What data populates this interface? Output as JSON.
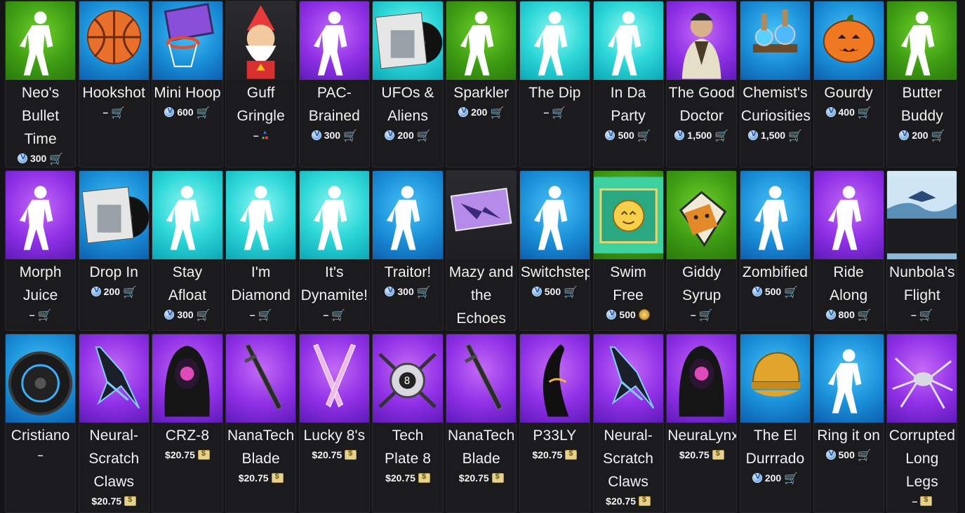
{
  "rows": [
    [
      {
        "name": "Neo's Bullet Time",
        "price": "300",
        "cur": "vbucks",
        "bg": "green",
        "icon": "emote-silhouette-icon"
      },
      {
        "name": "Hookshot",
        "price": "–",
        "cur": "cart",
        "bg": "blue",
        "icon": "basketball-icon"
      },
      {
        "name": "Mini Hoop",
        "price": "600",
        "cur": "vbucks",
        "bg": "blue",
        "icon": "basketball-hoop-icon"
      },
      {
        "name": "Guff Gringle",
        "price": "–",
        "cur": "platforms",
        "bg": "gray",
        "icon": "gnome-character-icon"
      },
      {
        "name": "PAC-Brained",
        "price": "300",
        "cur": "vbucks",
        "bg": "purple",
        "icon": "emote-silhouette-icon"
      },
      {
        "name": "UFOs & Aliens",
        "price": "200",
        "cur": "vbucks",
        "bg": "cyan",
        "icon": "music-pack-icon"
      },
      {
        "name": "Sparkler",
        "price": "200",
        "cur": "vbucks",
        "bg": "green",
        "icon": "emote-silhouette-icon"
      },
      {
        "name": "The Dip",
        "price": "–",
        "cur": "cart",
        "bg": "cyan",
        "icon": "emote-silhouette-icon"
      },
      {
        "name": "In Da Party",
        "price": "500",
        "cur": "vbucks",
        "bg": "cyan",
        "icon": "emote-silhouette-icon"
      },
      {
        "name": "The Good Doctor",
        "price": "1,500",
        "cur": "vbucks",
        "bg": "purple",
        "icon": "outfit-character-icon"
      },
      {
        "name": "Chemist's Curiosities",
        "price": "1,500",
        "cur": "vbucks",
        "bg": "blue",
        "icon": "chemistry-set-icon"
      },
      {
        "name": "Gourdy",
        "price": "400",
        "cur": "vbucks",
        "bg": "blue",
        "icon": "pumpkin-icon"
      },
      {
        "name": "Butter Buddy",
        "price": "200",
        "cur": "vbucks",
        "bg": "green",
        "icon": "emote-silhouette-icon"
      }
    ],
    [
      {
        "name": "Morph Juice",
        "price": "–",
        "cur": "cart",
        "bg": "purple",
        "icon": "emote-silhouette-icon"
      },
      {
        "name": "Drop In",
        "price": "200",
        "cur": "vbucks",
        "bg": "blue",
        "icon": "music-pack-icon"
      },
      {
        "name": "Stay Afloat",
        "price": "300",
        "cur": "vbucks",
        "bg": "cyan",
        "icon": "emote-silhouette-icon"
      },
      {
        "name": "I'm Diamond",
        "price": "–",
        "cur": "cart",
        "bg": "cyan",
        "icon": "emote-silhouette-icon"
      },
      {
        "name": "It's Dynamite!",
        "price": "–",
        "cur": "cart",
        "bg": "cyan",
        "icon": "emote-silhouette-icon"
      },
      {
        "name": "Traitor!",
        "price": "300",
        "cur": "vbucks",
        "bg": "blue",
        "icon": "emote-silhouette-icon"
      },
      {
        "name": "Mazy and the Echoes",
        "price": "–",
        "cur": "cart",
        "bg": "gray",
        "icon": "loading-screen-icon"
      },
      {
        "name": "Switchstep",
        "price": "500",
        "cur": "vbucks",
        "bg": "blue",
        "icon": "emote-silhouette-icon"
      },
      {
        "name": "Swim Free",
        "price": "500",
        "cur": "medal",
        "bg": "green",
        "icon": "wrap-pattern-icon"
      },
      {
        "name": "Giddy Syrup",
        "price": "–",
        "cur": "cart",
        "bg": "green",
        "icon": "syrup-spray-icon"
      },
      {
        "name": "Zombified",
        "price": "500",
        "cur": "vbucks",
        "bg": "blue",
        "icon": "emote-silhouette-icon"
      },
      {
        "name": "Ride Along",
        "price": "800",
        "cur": "vbucks",
        "bg": "purple",
        "icon": "emote-silhouette-icon"
      },
      {
        "name": "Nunbola's Flight",
        "price": "–",
        "cur": "cart",
        "bg": "sky",
        "icon": "landscape-icon"
      }
    ],
    [
      {
        "name": "Cristiano",
        "price": "–",
        "cur": "none",
        "bg": "blue",
        "icon": "car-wheel-icon"
      },
      {
        "name": "Neural-Scratch Claws",
        "price": "$20.75",
        "cur": "cash",
        "bg": "purple",
        "icon": "claws-weapon-icon"
      },
      {
        "name": "CRZ-8",
        "price": "$20.75",
        "cur": "cash",
        "bg": "purple",
        "icon": "hooded-character-icon"
      },
      {
        "name": "NanaTech Blade",
        "price": "$20.75",
        "cur": "cash",
        "bg": "purple",
        "icon": "sword-icon"
      },
      {
        "name": "Lucky 8's",
        "price": "$20.75",
        "cur": "cash",
        "bg": "purple",
        "icon": "dual-blades-icon"
      },
      {
        "name": "Tech Plate 8",
        "price": "$20.75",
        "cur": "cash",
        "bg": "purple",
        "icon": "back-bling-icon"
      },
      {
        "name": "NanaTech Blade",
        "price": "$20.75",
        "cur": "cash",
        "bg": "purple",
        "icon": "sword-icon"
      },
      {
        "name": "P33LY",
        "price": "$20.75",
        "cur": "cash",
        "bg": "purple",
        "icon": "banana-character-icon"
      },
      {
        "name": "Neural-Scratch Claws",
        "price": "$20.75",
        "cur": "cash",
        "bg": "purple",
        "icon": "claws-weapon-icon"
      },
      {
        "name": "NeuraLynx",
        "price": "$20.75",
        "cur": "cash",
        "bg": "purple",
        "icon": "hooded-character-icon"
      },
      {
        "name": "The El Durrrado",
        "price": "200",
        "cur": "vbucks",
        "bg": "blue",
        "icon": "golden-burger-icon"
      },
      {
        "name": "Ring it on",
        "price": "500",
        "cur": "vbucks",
        "bg": "blue",
        "icon": "emote-silhouette-icon"
      },
      {
        "name": "Corrupted Long Legs",
        "price": "–",
        "cur": "cash",
        "bg": "purple",
        "icon": "spider-glider-icon"
      }
    ]
  ]
}
